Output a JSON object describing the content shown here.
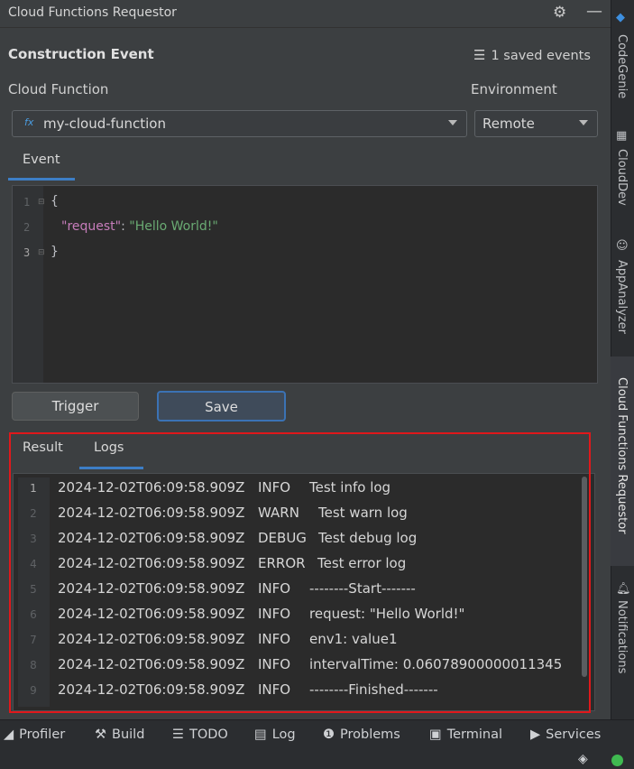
{
  "window": {
    "title": "Cloud Functions Requestor"
  },
  "construction": {
    "title": "Construction Event",
    "saved_events": "1 saved events",
    "function_label": "Cloud Function",
    "environment_label": "Environment",
    "function_icon": "fx",
    "function_value": "my-cloud-function",
    "environment_value": "Remote"
  },
  "event_tab": {
    "label": "Event"
  },
  "editor": {
    "lines": [
      {
        "num": "1",
        "parts": [
          "{"
        ]
      },
      {
        "num": "2",
        "key": "\"request\"",
        "sep": ": ",
        "value": "\"Hello World!\""
      },
      {
        "num": "3",
        "parts": [
          "}"
        ]
      }
    ]
  },
  "buttons": {
    "trigger": "Trigger",
    "save": "Save"
  },
  "result_tabs": {
    "result": "Result",
    "logs": "Logs"
  },
  "logs": [
    {
      "num": "1",
      "timestamp": "2024-12-02T06:09:58.909Z",
      "level": "INFO",
      "message": "Test info log"
    },
    {
      "num": "2",
      "timestamp": "2024-12-02T06:09:58.909Z",
      "level": "WARN",
      "message": "Test warn log"
    },
    {
      "num": "3",
      "timestamp": "2024-12-02T06:09:58.909Z",
      "level": "DEBUG",
      "message": "Test debug log"
    },
    {
      "num": "4",
      "timestamp": "2024-12-02T06:09:58.909Z",
      "level": "ERROR",
      "message": "Test error log"
    },
    {
      "num": "5",
      "timestamp": "2024-12-02T06:09:58.909Z",
      "level": "INFO",
      "message": "--------Start-------"
    },
    {
      "num": "6",
      "timestamp": "2024-12-02T06:09:58.909Z",
      "level": "INFO",
      "message": "request: \"Hello World!\""
    },
    {
      "num": "7",
      "timestamp": "2024-12-02T06:09:58.909Z",
      "level": "INFO",
      "message": "env1: value1"
    },
    {
      "num": "8",
      "timestamp": "2024-12-02T06:09:58.909Z",
      "level": "INFO",
      "message": "intervalTime: 0.06078900000011345"
    },
    {
      "num": "9",
      "timestamp": "2024-12-02T06:09:58.909Z",
      "level": "INFO",
      "message": "--------Finished-------"
    }
  ],
  "right_sidebar": {
    "codegenie": "CodeGenie",
    "clouddev": "CloudDev",
    "appanalyzer": "AppAnalyzer",
    "requestor": "Cloud Functions Requestor",
    "notifications": "Notifications"
  },
  "bottom_toolbar": {
    "profiler": "Profiler",
    "build": "Build",
    "todo": "TODO",
    "log": "Log",
    "problems": "Problems",
    "terminal": "Terminal",
    "services": "Services"
  },
  "colors": {
    "accent": "#3d7ec6",
    "highlight": "#e0181b",
    "status_ok": "#3fb950"
  }
}
